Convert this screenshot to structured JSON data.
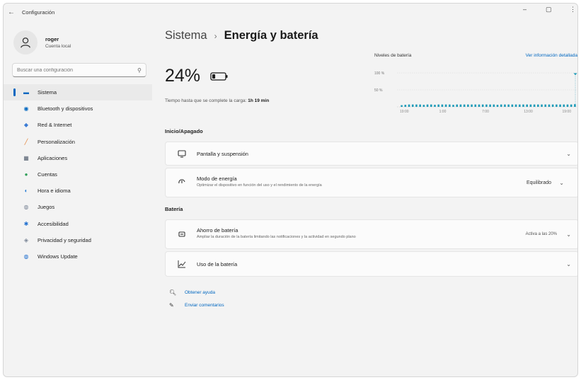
{
  "app": {
    "title": "Configuración",
    "back_icon": "back-arrow-icon"
  },
  "window_controls": {
    "minimize": "–",
    "maximize": "▢",
    "close": "⋮"
  },
  "profile": {
    "name": "roger",
    "type": "Cuenta local"
  },
  "search": {
    "placeholder": "Buscar una configuración"
  },
  "nav": [
    {
      "label": "Sistema",
      "icon": "system-icon",
      "color": "#0067c0",
      "active": true
    },
    {
      "label": "Bluetooth y dispositivos",
      "icon": "bluetooth-icon",
      "color": "#0067c0"
    },
    {
      "label": "Red & Internet",
      "icon": "network-icon",
      "color": "#3a7bd5"
    },
    {
      "label": "Personalización",
      "icon": "brush-icon",
      "color": "#e07a2b"
    },
    {
      "label": "Aplicaciones",
      "icon": "apps-icon",
      "color": "#556070"
    },
    {
      "label": "Cuentas",
      "icon": "accounts-icon",
      "color": "#2e9e57"
    },
    {
      "label": "Hora e idioma",
      "icon": "globe-clock-icon",
      "color": "#2a7fd4"
    },
    {
      "label": "Juegos",
      "icon": "gamepad-icon",
      "color": "#7a8596"
    },
    {
      "label": "Accesibilidad",
      "icon": "accessibility-icon",
      "color": "#1f6fcf"
    },
    {
      "label": "Privacidad y seguridad",
      "icon": "shield-icon",
      "color": "#7a8596"
    },
    {
      "label": "Windows Update",
      "icon": "update-icon",
      "color": "#1f6fcf"
    }
  ],
  "breadcrumb": {
    "parent": "Sistema",
    "separator": "›",
    "current": "Energía y batería"
  },
  "battery": {
    "percent_text": "24%",
    "level": 0.24,
    "charge_label": "Tiempo hasta que se complete la carga:",
    "charge_time": "1h 19 min"
  },
  "chart": {
    "title": "Niveles de batería",
    "link": "Ver información detallada"
  },
  "chart_data": {
    "type": "bar",
    "title": "Niveles de batería",
    "y_ticks": [
      "100 %",
      "50 %"
    ],
    "ylim": [
      0,
      100
    ],
    "x_ticks": [
      "19:00",
      "1:00",
      "7:00",
      "13:00",
      "19:00"
    ],
    "values": [
      5,
      6,
      7,
      7,
      7,
      7,
      6,
      7,
      7,
      6,
      7,
      7,
      7,
      7,
      6,
      7,
      7,
      7,
      7,
      7,
      7,
      7,
      7,
      7,
      7,
      7,
      6,
      7,
      7,
      7,
      7,
      7,
      7,
      7,
      7,
      7,
      7,
      7,
      7,
      7,
      7,
      7,
      7,
      7,
      7,
      7,
      7,
      8
    ],
    "marker": {
      "label": "current",
      "value": 95
    },
    "grid": true,
    "bar_color": "#1f9bb8"
  },
  "sections": {
    "power": {
      "title": "Inicio/Apagado",
      "screen": {
        "title": "Pantalla y suspensión",
        "icon": "monitor-sleep-icon"
      },
      "mode": {
        "title": "Modo de energía",
        "subtitle": "Optimizar el dispositivo en función del uso y el rendimiento de la energía",
        "value": "Equilibrado",
        "icon": "power-mode-icon"
      }
    },
    "battery": {
      "title": "Batería",
      "saver": {
        "title": "Ahorro de batería",
        "subtitle": "Ampliar la duración de la batería limitando las notificaciones y la actividad en segundo plano",
        "value": "Activa a las 20%",
        "icon": "battery-saver-icon"
      },
      "usage": {
        "title": "Uso de la batería",
        "icon": "chart-line-icon"
      }
    }
  },
  "help": {
    "get_help": "Obtener ayuda",
    "feedback": "Enviar comentarios"
  }
}
